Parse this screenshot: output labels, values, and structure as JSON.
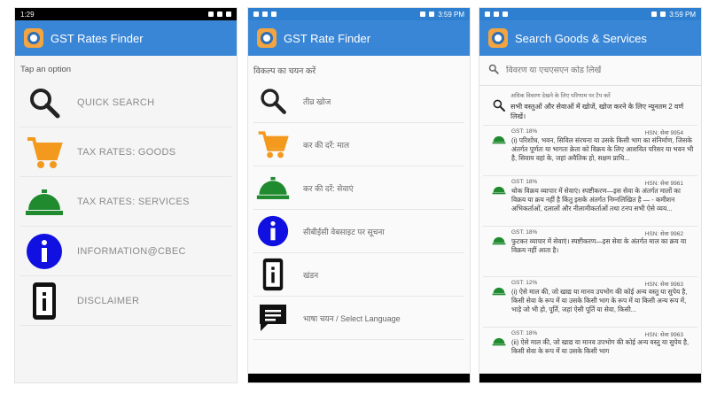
{
  "phone1": {
    "status_time": "1:29",
    "title": "GST Rates Finder",
    "hint": "Tap an option",
    "menu": [
      {
        "label": "QUICK SEARCH",
        "icon": "search-icon"
      },
      {
        "label": "TAX RATES: GOODS",
        "icon": "shopping-cart-icon"
      },
      {
        "label": "TAX RATES: SERVICES",
        "icon": "service-bell-icon"
      },
      {
        "label": "INFORMATION@CBEC",
        "icon": "info-icon"
      },
      {
        "label": "DISCLAIMER",
        "icon": "phone-info-icon"
      }
    ]
  },
  "phone2": {
    "status_time": "3:59 PM",
    "title": "GST Rate Finder",
    "hint": "विकल्प का चयन करें",
    "menu": [
      {
        "label": "तीव्र खोज",
        "icon": "search-icon"
      },
      {
        "label": "कर की दरें: माल",
        "icon": "shopping-cart-icon"
      },
      {
        "label": "कर की दरें: सेवाएं",
        "icon": "service-bell-icon"
      },
      {
        "label": "सीबीईसी वेबसाइट पर सूचना",
        "icon": "info-icon"
      },
      {
        "label": "खंडन",
        "icon": "phone-info-icon"
      },
      {
        "label": "भाषा चयन / Select Language",
        "icon": "chat-icon"
      }
    ]
  },
  "phone3": {
    "status_time": "3:59 PM",
    "title": "Search Goods & Services",
    "search_placeholder": "विवरण या एचएसएन कोड लिखें",
    "intro_small": "अधिक विवरण देखने के लिए परिणाम पर टैप करें",
    "intro_text": "सभी वस्तुओं और सेवाओं में खोजें, खोज करने के लिए न्यूनतम 2 वर्ण लिखें।",
    "results": [
      {
        "gst": "GST: 18%",
        "hsn": "HSN: सेवा 9954",
        "desc": "(i) परिशोध, भवन, सिविल संरचना या उसके किसी भाग का संनिर्माण, जिसके अंतर्गत पूर्णतः या भागतः क्रेता को विक्रय के लिए आशयित परिसर या भवन भी है, सिवाय वहां के, जहां अवैतिक हो, सक्षम प्राधि..."
      },
      {
        "gst": "GST: 18%",
        "hsn": "HSN: सेवा 9961",
        "desc": "थोक विक्रय व्यापार में सेवाएं। स्पष्टीकरण—इस सेवा के अंतर्गत मालों का विक्रय या क्रय नहीं है किंतु इसके अंतर्गत निम्नलिखित है — - कमीशन अभिकर्ताओं, दलालों और नीलामीकर्ताओं तथा टनप सभी ऐसे व्यय..."
      },
      {
        "gst": "GST: 18%",
        "hsn": "HSN: सेवा 9962",
        "desc": "फुटकर व्यापार में सेवाएं। स्पष्टीकरण—इस सेवा के अंतर्गत माल का क्रय या विक्रय नहीं आता है।"
      },
      {
        "gst": "GST: 12%",
        "hsn": "HSN: सेवा 9963",
        "desc": "(i) ऐसे माल की, जो खाद्य या मानव उपभोग की कोई अन्य वस्तु या सुपेय है, किसी सेवा के रूप में या उसके किसी भाग के रूप में या किसी अन्य रूप में, भाड़े जो भी हो, पूर्ति, जहां ऐसी पूर्ति या सेवा, किसी..."
      },
      {
        "gst": "GST: 18%",
        "hsn": "HSN: सेवा 9963",
        "desc": "(ii) ऐसे माल की, जो खाद्य या मानव उपभोग की कोई अन्य वस्तु या सुपेय है, किसी सेवा के रूप में या उसके किसी भाग"
      }
    ]
  },
  "colors": {
    "appbar": "#3a86d6",
    "search_icon": "#222222",
    "cart": "#f39a1e",
    "bell": "#1f8a2e",
    "info": "#1010e0"
  }
}
